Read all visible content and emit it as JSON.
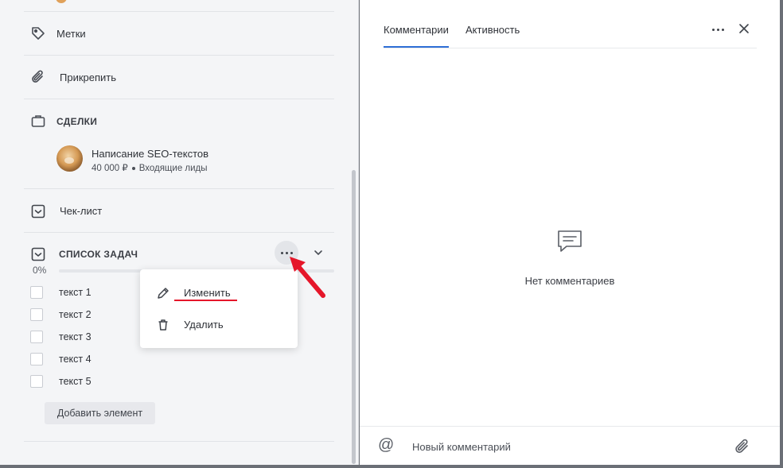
{
  "left_panel": {
    "labels_row": {
      "icon": "tag-icon",
      "label": "Метки"
    },
    "attach_row": {
      "icon": "paperclip-icon",
      "label": "Прикрепить"
    },
    "deals": {
      "icon": "briefcase-icon",
      "title": "СДЕЛКИ",
      "item": {
        "title": "Написание SEO-текстов",
        "amount": "40 000 ₽",
        "stage": "Входящие лиды"
      }
    },
    "checklist_row": {
      "icon": "checkbox-icon",
      "label": "Чек-лист"
    },
    "task_list": {
      "icon": "checkbox-icon",
      "title": "СПИСОК ЗАДАЧ",
      "progress_label": "0%",
      "progress_value": 0,
      "items": [
        {
          "label": "текст 1",
          "checked": false
        },
        {
          "label": "текст 2",
          "checked": false
        },
        {
          "label": "текст 3",
          "checked": false
        },
        {
          "label": "текст 4",
          "checked": false
        },
        {
          "label": "текст 5",
          "checked": false
        }
      ],
      "add_button": "Добавить элемент"
    }
  },
  "context_menu": {
    "items": [
      {
        "icon": "pencil-icon",
        "label": "Изменить"
      },
      {
        "icon": "trash-icon",
        "label": "Удалить"
      }
    ]
  },
  "right_panel": {
    "tabs": [
      {
        "label": "Комментарии",
        "active": true
      },
      {
        "label": "Активность",
        "active": false
      }
    ],
    "empty_state": {
      "icon": "comment-icon",
      "text": "Нет комментариев"
    },
    "composer": {
      "placeholder": "Новый комментарий",
      "value": ""
    }
  },
  "colors": {
    "accent": "#2f6fd6",
    "annotation": "#e5162a"
  }
}
